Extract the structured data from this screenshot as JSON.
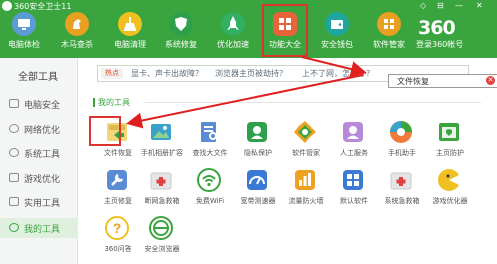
{
  "window": {
    "title": "360安全卫士11",
    "controls": [
      "◇",
      "⊟",
      "—",
      "✕"
    ]
  },
  "nav": [
    {
      "label": "电脑体检",
      "icon": "monitor-icon",
      "color": "#5b9bd5"
    },
    {
      "label": "木马查杀",
      "icon": "horse-icon",
      "color": "#e8a020"
    },
    {
      "label": "电脑清理",
      "icon": "broom-icon",
      "color": "#f0c020"
    },
    {
      "label": "系统修复",
      "icon": "shield-icon",
      "color": "#2ea04a"
    },
    {
      "label": "优化加速",
      "icon": "rocket-icon",
      "color": "#30b060"
    },
    {
      "label": "功能大全",
      "icon": "grid-icon",
      "color": "#e8623a",
      "active": true
    },
    {
      "label": "安全钱包",
      "icon": "wallet-icon",
      "color": "#1ea5a0"
    },
    {
      "label": "软件管家",
      "icon": "apps-icon",
      "color": "#e8a020"
    }
  ],
  "brand": {
    "logo": "360",
    "login": "登录360帐号"
  },
  "sidebar": {
    "all": "全部工具",
    "items": [
      "电脑安全",
      "网络优化",
      "系统工具",
      "游戏优化",
      "实用工具",
      "我的工具"
    ]
  },
  "hotbar": {
    "tag": "热点",
    "links": [
      "显卡、声卡出故障？",
      "浏览器主页被劫持？",
      "上不了网，怎么办？"
    ]
  },
  "search": {
    "value": "文件恢复"
  },
  "mytools": {
    "title": "我的工具",
    "items": [
      {
        "label": "文件恢复",
        "icon": "file-restore-icon"
      },
      {
        "label": "手机相册扩容",
        "icon": "photo-icon"
      },
      {
        "label": "查找大文件",
        "icon": "find-file-icon"
      },
      {
        "label": "隐私保护",
        "icon": "privacy-icon"
      },
      {
        "label": "软件管家",
        "icon": "software-manager-icon"
      },
      {
        "label": "人工服务",
        "icon": "support-icon"
      },
      {
        "label": "手机助手",
        "icon": "phone-assistant-icon"
      },
      {
        "label": "主页防护",
        "icon": "homepage-protect-icon"
      },
      {
        "label": "主页修复",
        "icon": "wrench-icon"
      },
      {
        "label": "断网急救箱",
        "icon": "first-aid-icon"
      },
      {
        "label": "免费WiFi",
        "icon": "wifi-icon"
      },
      {
        "label": "宽带测速器",
        "icon": "speedometer-icon"
      },
      {
        "label": "流量防火墙",
        "icon": "firewall-icon"
      },
      {
        "label": "默认软件",
        "icon": "default-software-icon"
      },
      {
        "label": "系统急救箱",
        "icon": "system-first-aid-icon"
      },
      {
        "label": "游戏优化器",
        "icon": "game-optimizer-icon"
      },
      {
        "label": "360问答",
        "icon": "question-icon"
      },
      {
        "label": "安全浏览器",
        "icon": "browser-icon"
      }
    ]
  }
}
